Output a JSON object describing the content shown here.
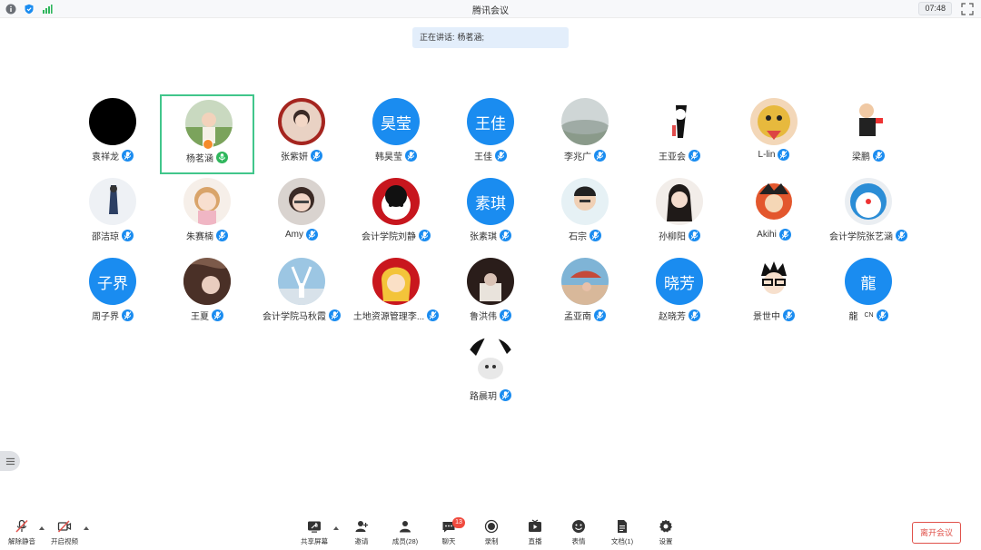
{
  "window": {
    "title": "腾讯会议",
    "time": "07:48"
  },
  "speaking": {
    "label": "正在讲话:",
    "name": "杨茗涵;"
  },
  "colors": {
    "avatar_blue": "#1a8cf0",
    "active_border": "#41c68b",
    "leave_red": "#e0524b",
    "badge_red": "#f04a3e"
  },
  "participants": [
    {
      "name": "袁祥龙",
      "avatar": "photo",
      "mic": "muted"
    },
    {
      "name": "杨茗涵",
      "avatar": "photo",
      "mic": "speaking",
      "active": true
    },
    {
      "name": "张紫妍",
      "avatar": "photo",
      "mic": "muted"
    },
    {
      "name": "韩昊莹",
      "avatar": "昊莹",
      "mic": "muted"
    },
    {
      "name": "王佳",
      "avatar": "王佳",
      "mic": "muted"
    },
    {
      "name": "李兆广",
      "avatar": "photo",
      "mic": "muted"
    },
    {
      "name": "王亚会",
      "avatar": "photo",
      "mic": "muted"
    },
    {
      "name": "L-lin",
      "avatar": "photo",
      "mic": "muted"
    },
    {
      "name": "梁鹏",
      "avatar": "photo",
      "mic": "muted"
    },
    {
      "name": "邵洁琼",
      "avatar": "photo",
      "mic": "muted"
    },
    {
      "name": "朱赛楠",
      "avatar": "photo",
      "mic": "muted"
    },
    {
      "name": "Amy",
      "avatar": "photo",
      "mic": "muted"
    },
    {
      "name": "会计学院刘静",
      "avatar": "photo",
      "mic": "muted"
    },
    {
      "name": "张素琪",
      "avatar": "素琪",
      "mic": "muted"
    },
    {
      "name": "石宗",
      "avatar": "photo",
      "mic": "muted"
    },
    {
      "name": "孙柳阳",
      "avatar": "photo",
      "mic": "muted"
    },
    {
      "name": "Akihi",
      "avatar": "photo",
      "mic": "muted"
    },
    {
      "name": "会计学院张艺涵",
      "avatar": "photo",
      "mic": "muted"
    },
    {
      "name": "周子界",
      "avatar": "子界",
      "mic": "muted"
    },
    {
      "name": "王夏",
      "avatar": "photo",
      "mic": "muted"
    },
    {
      "name": "会计学院马秋霞",
      "avatar": "photo",
      "mic": "muted"
    },
    {
      "name": "土地资源管理李...",
      "avatar": "photo",
      "mic": "muted"
    },
    {
      "name": "鲁洪伟",
      "avatar": "photo",
      "mic": "muted"
    },
    {
      "name": "孟亚南",
      "avatar": "photo",
      "mic": "muted"
    },
    {
      "name": "赵晓芳",
      "avatar": "晓芳",
      "mic": "muted"
    },
    {
      "name": "景世中",
      "avatar": "photo",
      "mic": "muted"
    },
    {
      "name": "龍",
      "avatar": "龍",
      "mic": "muted",
      "tag": "CN"
    },
    {
      "name": "路晨玥",
      "avatar": "photo",
      "mic": "muted"
    }
  ],
  "toolbar": {
    "unmute": "解除静音",
    "start_video": "开启视频",
    "share_screen": "共享屏幕",
    "invite": "邀请",
    "members": "成员(28)",
    "chat": "聊天",
    "chat_badge": "13",
    "record": "录制",
    "live": "直播",
    "reactions": "表情",
    "docs": "文档(1)",
    "settings": "设置",
    "leave": "离开会议"
  }
}
